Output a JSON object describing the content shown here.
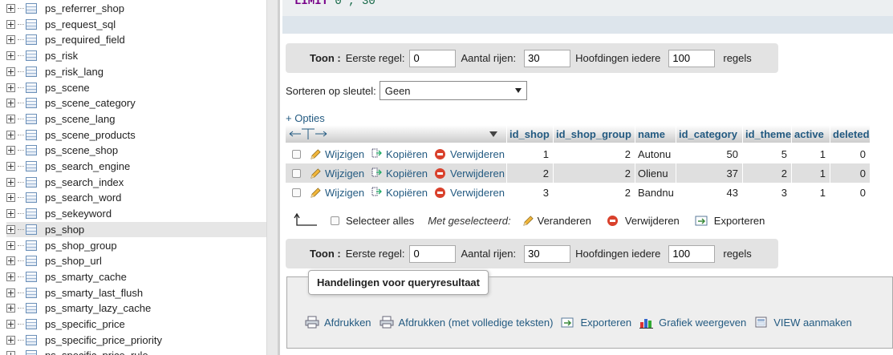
{
  "sidebar": {
    "items": [
      {
        "label": "ps_referrer_shop"
      },
      {
        "label": "ps_request_sql"
      },
      {
        "label": "ps_required_field"
      },
      {
        "label": "ps_risk"
      },
      {
        "label": "ps_risk_lang"
      },
      {
        "label": "ps_scene"
      },
      {
        "label": "ps_scene_category"
      },
      {
        "label": "ps_scene_lang"
      },
      {
        "label": "ps_scene_products"
      },
      {
        "label": "ps_scene_shop"
      },
      {
        "label": "ps_search_engine"
      },
      {
        "label": "ps_search_index"
      },
      {
        "label": "ps_search_word"
      },
      {
        "label": "ps_sekeyword"
      },
      {
        "label": "ps_shop"
      },
      {
        "label": "ps_shop_group"
      },
      {
        "label": "ps_shop_url"
      },
      {
        "label": "ps_smarty_cache"
      },
      {
        "label": "ps_smarty_last_flush"
      },
      {
        "label": "ps_smarty_lazy_cache"
      },
      {
        "label": "ps_specific_price"
      },
      {
        "label": "ps_specific_price_priority"
      },
      {
        "label": "ps_specific_price_rule"
      }
    ],
    "active_index": 14
  },
  "sql": {
    "keyword": "LIMIT",
    "args": "0 , 30"
  },
  "nav": {
    "show_label": "Toon :",
    "first_row_label": "Eerste regel:",
    "first_row_value": "0",
    "rows_label": "Aantal rijen:",
    "rows_value": "30",
    "headers_label": "Hoofdingen iedere",
    "headers_value": "100",
    "rows_suffix": "regels"
  },
  "sort": {
    "label": "Sorteren op sleutel:",
    "value": "Geen"
  },
  "options_link": "+ Opties",
  "table": {
    "columns": [
      "id_shop",
      "id_shop_group",
      "name",
      "id_category",
      "id_theme",
      "active",
      "deleted"
    ],
    "actions": {
      "edit": "Wijzigen",
      "copy": "Kopiëren",
      "delete": "Verwijderen"
    },
    "rows": [
      [
        "1",
        "2",
        "Autonu",
        "50",
        "5",
        "1",
        "0"
      ],
      [
        "2",
        "2",
        "Olienu",
        "37",
        "2",
        "1",
        "0"
      ],
      [
        "3",
        "2",
        "Bandnu",
        "43",
        "3",
        "1",
        "0"
      ]
    ]
  },
  "bulk": {
    "select_all": "Selecteer alles",
    "with_selected": "Met geselecteerd:",
    "change": "Veranderen",
    "delete": "Verwijderen",
    "export": "Exporteren"
  },
  "query_actions": {
    "legend": "Handelingen voor queryresultaat",
    "print": "Afdrukken",
    "print_full": "Afdrukken (met volledige teksten)",
    "export": "Exporteren",
    "chart": "Grafiek weergeven",
    "create_view": "VIEW aanmaken"
  },
  "colors": {
    "link": "#235a81",
    "keyword": "#770088",
    "delete_red": "#d9412c"
  }
}
